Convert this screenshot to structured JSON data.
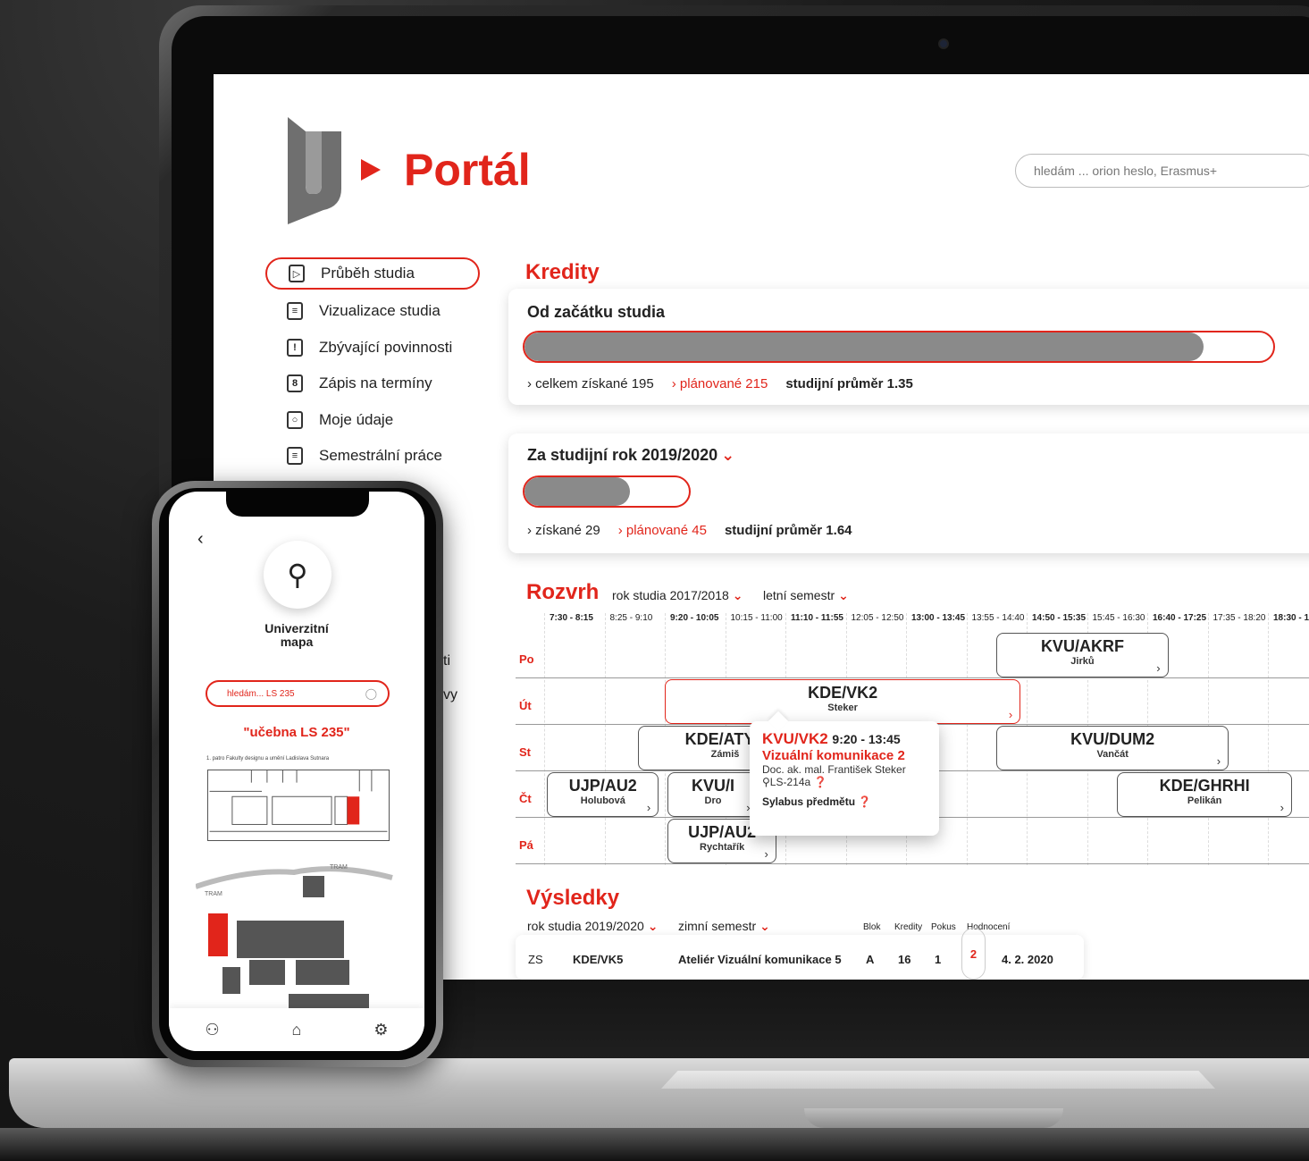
{
  "portal": {
    "brand": "Portál",
    "search_placeholder": "hledám ... orion heslo, Erasmus+",
    "nav": [
      {
        "label": "Průběh studia",
        "icon": "play-step-icon"
      },
      {
        "label": "Vizualizace studia",
        "icon": "document-list-icon"
      },
      {
        "label": "Zbývající povinnosti",
        "icon": "exclamation-icon"
      },
      {
        "label": "Zápis na termíny",
        "icon": "calendar-icon"
      },
      {
        "label": "Moje údaje",
        "icon": "user-card-icon"
      },
      {
        "label": "Semestrální práce",
        "icon": "document-icon"
      }
    ],
    "nav_peek": [
      "ti",
      "vy"
    ],
    "credits": {
      "heading": "Kredity",
      "total_card": {
        "title": "Od začátku studia",
        "earned": "› celkem získané 195",
        "planned": "› plánované 215",
        "gpa": "studijní průměr 1.35",
        "progress_fraction": 0.907
      },
      "year_card": {
        "title": "Za studijní rok 2019/2020",
        "earned": "› získané 29",
        "planned": "› plánované 45",
        "gpa": "studijní průměr 1.64",
        "progress_fraction": 0.644
      }
    },
    "schedule": {
      "heading": "Rozvrh",
      "year_select": "rok studia 2017/2018",
      "semester_select": "letní semestr",
      "times": [
        "7:30 - 8:15",
        "8:25 - 9:10",
        "9:20 - 10:05",
        "10:15 - 11:00",
        "11:10 - 11:55",
        "12:05 - 12:50",
        "13:00 - 13:45",
        "13:55 - 14:40",
        "14:50 - 15:35",
        "15:45 - 16:30",
        "16:40 - 17:25",
        "17:35 - 18:20",
        "18:30 - 1"
      ],
      "days": [
        "Po",
        "Út",
        "St",
        "Čt",
        "Pá"
      ],
      "slots": [
        {
          "code": "KVU/AKRF",
          "teacher": "Jirků"
        },
        {
          "code": "KDE/VK2",
          "teacher": "Steker"
        },
        {
          "code": "KDE/ATYP",
          "teacher": "Zámiš"
        },
        {
          "code": "KVU/DUM2",
          "teacher": "Vančát"
        },
        {
          "code": "UJP/AU2",
          "teacher": "Holubová"
        },
        {
          "code": "KVU/I",
          "teacher": "Dro"
        },
        {
          "code": "KDE/GHRHI",
          "teacher": "Pelikán"
        },
        {
          "code": "UJP/AU2",
          "teacher": "Rychtařík"
        }
      ],
      "popup": {
        "code": "KVU/VK2",
        "time": "9:20 - 13:45",
        "name": "Vizuální komunikace 2",
        "teacher": "Doc. ak. mal. František Steker",
        "room": "LS-214a",
        "link": "Sylabus předmětu"
      }
    },
    "results": {
      "heading": "Výsledky",
      "year_select": "rok studia 2019/2020",
      "semester_select": "zimní semestr",
      "columns": [
        "Blok",
        "Kredity",
        "Pokus",
        "Hodnocení"
      ],
      "row": {
        "term": "ZS",
        "code": "KDE/VK5",
        "name": "Ateliér Vizuální komunikace 5",
        "block": "A",
        "credits": "16",
        "attempt": "1",
        "grade": "2",
        "date": "4. 2. 2020"
      }
    }
  },
  "phone": {
    "back": "‹",
    "title_line1": "Univerzitní",
    "title_line2": "mapa",
    "search_value": "hledám... LS 235",
    "result": "\"učebna LS 235\"",
    "floor_label": "1. patro Fakulty designu a umění Ladislava Sutnara",
    "map_labels": [
      "TRAM",
      "TRAM"
    ],
    "tabs": [
      "user-icon",
      "home-icon",
      "settings-icon"
    ]
  },
  "colors": {
    "accent": "#e1251b",
    "progress": "#8a8a8a"
  }
}
